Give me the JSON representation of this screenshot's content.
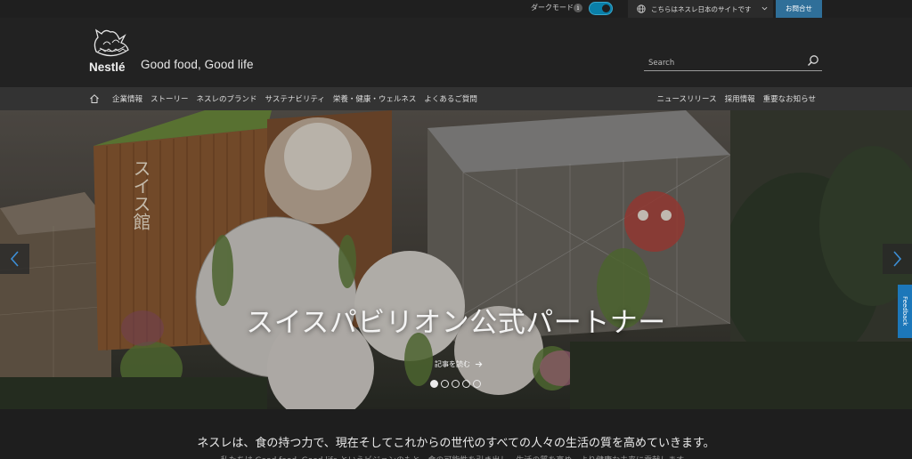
{
  "utility": {
    "dark_mode_label": "ダークモード",
    "info_icon": "i",
    "site_select_label": "こちらはネスレ日本のサイトです",
    "contact_label": "お問合せ"
  },
  "header": {
    "brand": "Nestlé",
    "tagline": "Good food, Good life",
    "search_placeholder": "Search"
  },
  "nav": {
    "left_items": [
      "企業情報",
      "ストーリー",
      "ネスレのブランド",
      "サステナビリティ",
      "栄養・健康・ウェルネス",
      "よくあるご質問"
    ],
    "right_items": [
      "ニュースリリース",
      "採用情報",
      "重要なお知らせ"
    ]
  },
  "hero": {
    "title": "スイスパビリオン公式パートナー",
    "read_more": "記事を読む",
    "building_sign": "スイス館",
    "slide_count": 5,
    "active_slide": 1
  },
  "feedback_label": "Feedback",
  "mission": {
    "headline": "ネスレは、食の持つ力で、現在そしてこれからの世代のすべての人々の生活の質を高めていきます。",
    "subtext": "私たちは Good food, Good life というビジョンのもと、食の可能性を引き出し、生活の質を高め、より健康な未来に貢献します。"
  },
  "colors": {
    "toggle": "#0a7fa8",
    "contact_bg": "#2f6f99",
    "feedback_bg": "#1c77b9",
    "nav_bg": "#333333",
    "header_bg": "#222222"
  }
}
